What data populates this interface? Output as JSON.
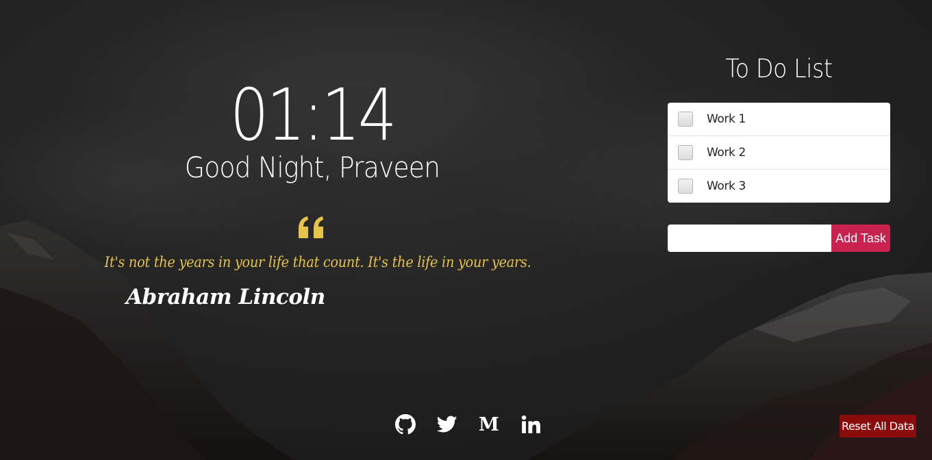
{
  "clock": {
    "time": "01:14"
  },
  "greeting": {
    "text": "Good Night, Praveen"
  },
  "quote": {
    "icon": "quote-left-icon",
    "text": "It's not the years in your life that count. It's the life in your years.",
    "author": "Abraham Lincoln",
    "color": "#e6c34a"
  },
  "todo": {
    "title": "To Do List",
    "items": [
      {
        "label": "Work 1",
        "checked": false
      },
      {
        "label": "Work 2",
        "checked": false
      },
      {
        "label": "Work 3",
        "checked": false
      }
    ],
    "input": {
      "value": "",
      "placeholder": ""
    },
    "add_label": "Add Task",
    "accent": "#c8234e"
  },
  "socials": [
    {
      "icon": "github-icon"
    },
    {
      "icon": "twitter-icon"
    },
    {
      "icon": "medium-icon",
      "glyph": "M"
    },
    {
      "icon": "linkedin-icon"
    }
  ],
  "reset": {
    "label": "Reset All Data",
    "color": "#8b0a0c"
  }
}
